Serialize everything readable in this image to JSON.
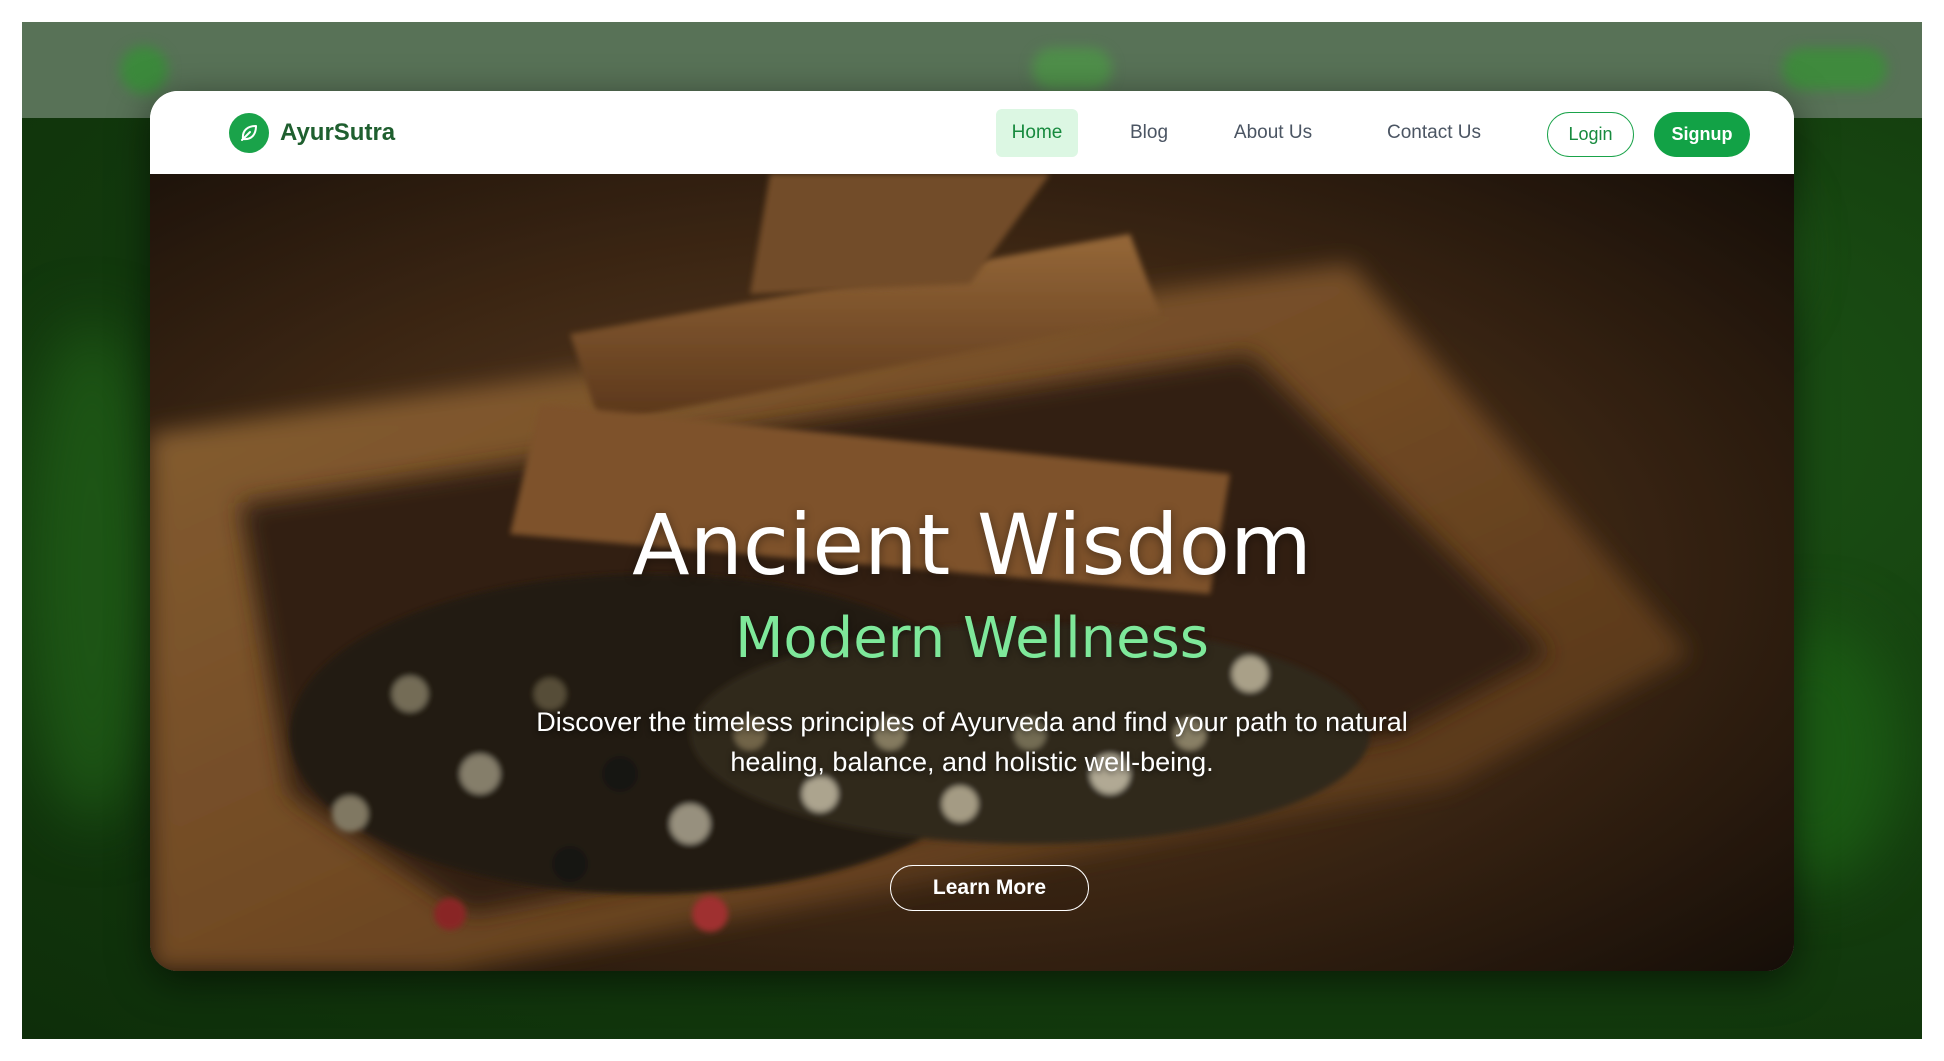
{
  "brand": {
    "name": "AyurSutra",
    "icon": "leaf-icon"
  },
  "nav": {
    "links": [
      {
        "label": "Home",
        "active": true
      },
      {
        "label": "Blog",
        "active": false
      },
      {
        "label": "About Us",
        "active": false
      },
      {
        "label": "Contact Us",
        "active": false
      }
    ],
    "login_label": "Login",
    "signup_label": "Signup"
  },
  "hero": {
    "title": "Ancient Wisdom",
    "subtitle": "Modern Wellness",
    "description": "Discover the timeless principles of Ayurveda and find your path to natural healing, balance, and holistic well-being.",
    "cta_label": "Learn More"
  },
  "colors": {
    "brand_green": "#12a246",
    "active_bg": "#dcf7e3",
    "subtitle_green": "#7ee89a",
    "text_gray": "#4b5563"
  }
}
